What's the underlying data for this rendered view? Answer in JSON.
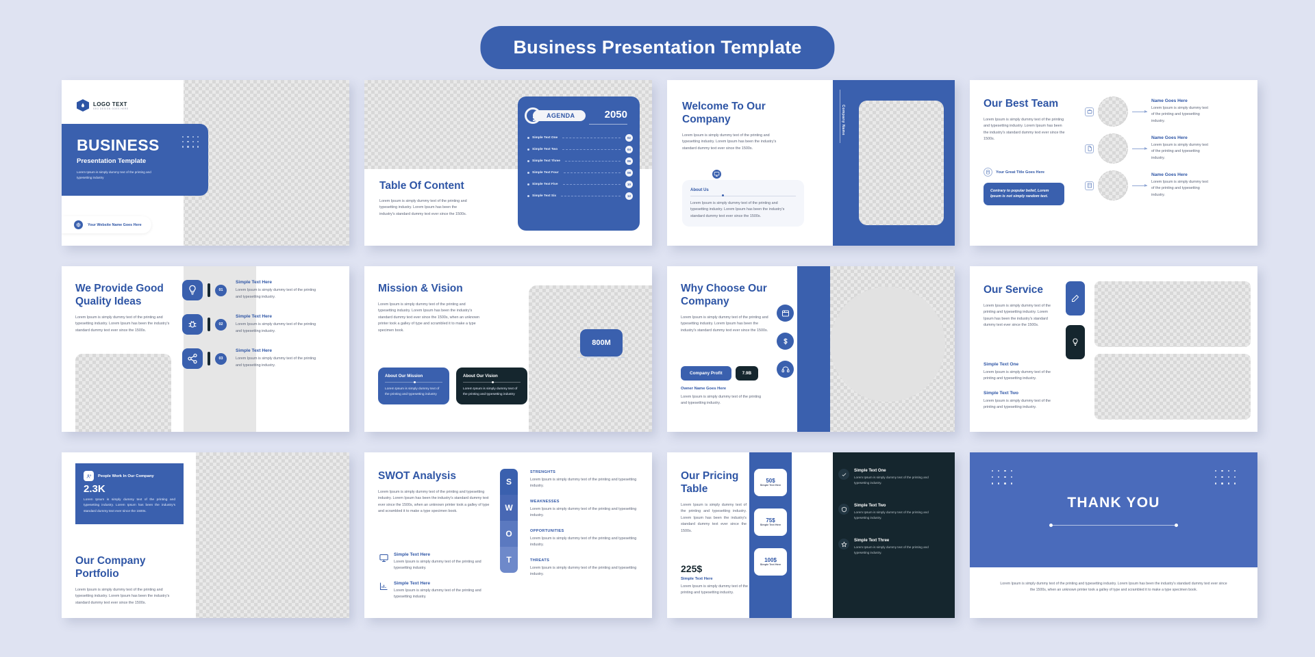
{
  "header": {
    "title": "Business Presentation Template",
    "accent": "#3a60ae"
  },
  "lorem": {
    "short": "Lorem Ipsum is simply dummy text of the printing and typesetting industry.",
    "medium": "Lorem Ipsum is simply dummy text of the printing and typesetting industry. Lorem Ipsum has been the industry's standard dummy text ever since the 1500s.",
    "long": "Lorem Ipsum is simply dummy text of the printing and typesetting industry. Lorem Ipsum has been the industry's standard dummy text ever since the 1500s, when an unknown printer took a galley of type and scrambled it to make a type specimen book.",
    "thanks": "Lorem Ipsum is simply dummy text of the printing and typesetting industry. Lorem Ipsum has been the industry's standard dummy text ever since the 1500s, when an unknown printer took a galley of type and scrambled it to make a type specimen book."
  },
  "slide1": {
    "logo_text": "LOGO TEXT",
    "logo_sub": "SEO DESIGN GOES HERE",
    "title": "BUSINESS",
    "subtitle": "Presentation Template",
    "desc": "Lorem Ipsum is simply dummy text of the printing and typesetting industry",
    "footer": "Your Website Name Goes Here"
  },
  "slide2": {
    "title": "Table Of Content",
    "desc": "Lorem Ipsum is simply dummy text of the printing and typesetting industry. Lorem Ipsum has been the industry's standard dummy text ever since the 1500s.",
    "agenda_label": "AGENDA",
    "year": "2050",
    "items": [
      {
        "label": "Simple Text One",
        "num": "02"
      },
      {
        "label": "Simple Text Two",
        "num": "04"
      },
      {
        "label": "Simple Text Three",
        "num": "06"
      },
      {
        "label": "Simple Text Four",
        "num": "08"
      },
      {
        "label": "Simple Text Five",
        "num": "10"
      },
      {
        "label": "Simple Text Six",
        "num": "12"
      }
    ]
  },
  "slide3": {
    "title": "Welcome To Our Company",
    "desc": "Lorem Ipsum is simply dummy text of the printing and typesetting industry. Lorem Ipsum has been the industry's standard dummy text ever since the 1500s.",
    "vertical_label": "Company Name",
    "about_title": "About Us",
    "about_desc": "Lorem Ipsum is simply dummy text of the printing and typesetting industry. Lorem Ipsum has been the industry's standard dummy text ever since the 1500s."
  },
  "slide4": {
    "title": "Our Best Team",
    "desc": "Lorem Ipsum is simply dummy text of the printing and typesetting industry. Lorem Ipsum has been the industry's standard dummy text ever since the 1500s.",
    "great_title": "Your Great Title Goes Here",
    "quote": "Contrary to popular belief, Lorem Ipsum is not simply random text.",
    "members": [
      {
        "name": "Name Goes Here",
        "desc": "Lorem Ipsum is simply dummy text of the printing and typesetting industry.",
        "icon": "briefcase-icon"
      },
      {
        "name": "Name Goes Here",
        "desc": "Lorem Ipsum is simply dummy text of the printing and typesetting industry.",
        "icon": "document-icon"
      },
      {
        "name": "Name Goes Here",
        "desc": "Lorem Ipsum is simply dummy text of the printing and typesetting industry.",
        "icon": "building-icon"
      }
    ]
  },
  "slide5": {
    "title": "We Provide Good Quality Ideas",
    "desc": "Lorem Ipsum is simply dummy text of the printing and typesetting industry. Lorem Ipsum has been the industry's standard dummy text ever since the 1500s.",
    "features": [
      {
        "num": "01",
        "title": "Simple Text Here",
        "desc": "Lorem Ipsum is simply dummy text of the printing and typesetting industry.",
        "icon": "lightbulb-icon"
      },
      {
        "num": "02",
        "title": "Simple Text Here",
        "desc": "Lorem Ipsum is simply dummy text of the printing and typesetting industry.",
        "icon": "bug-icon"
      },
      {
        "num": "03",
        "title": "Simple Text Here",
        "desc": "Lorem Ipsum is simply dummy text of the printing and typesetting industry.",
        "icon": "share-icon"
      }
    ]
  },
  "slide6": {
    "title": "Mission & Vision",
    "desc": "Lorem Ipsum is simply dummy text of the printing and typesetting industry. Lorem Ipsum has been the industry's standard dummy text ever since the 1500s, when an unknown printer took a galley of type and scrambled it to make a type specimen book.",
    "stat": "800M",
    "cards": [
      {
        "title": "About Our Mission",
        "desc": "Lorem Ipsum is simply dummy text of the printing and typesetting industry",
        "bg": "#3a60ae"
      },
      {
        "title": "About Our Vision",
        "desc": "Lorem Ipsum is simply dummy text of the printing and typesetting industry",
        "bg": "#15262e"
      }
    ]
  },
  "slide7": {
    "title": "Why Choose Our Company",
    "desc": "Lorem Ipsum is simply dummy text of the printing and typesetting industry. Lorem Ipsum has been the industry's standard dummy text ever since the 1500s.",
    "profit_label": "Company Profit",
    "profit_value": "7.9B",
    "owner": "Owner Name Goes Here",
    "owner_desc": "Lorem Ipsum is simply dummy text of the printing and typesetting industry."
  },
  "slide8": {
    "title": "Our Service",
    "desc": "Lorem Ipsum is simply dummy text of the printing and typesetting industry. Lorem Ipsum has been the industry's standard dummy text ever since the 1500s.",
    "items": [
      {
        "title": "Simple Text One",
        "desc": "Lorem Ipsum is simply dummy text of the printing and typesetting industry.",
        "icon": "edit-icon",
        "bg": "#3a60ae"
      },
      {
        "title": "Simple Text Two",
        "desc": "Lorem Ipsum is simply dummy text of the printing and typesetting industry.",
        "icon": "bulb-icon",
        "bg": "#15262e"
      }
    ]
  },
  "slide9": {
    "stat_label": "People Work In Our Company",
    "stat_value": "2.3K",
    "stat_desc": "Lorem Ipsum is simply dummy text of the printing and typesetting industry. Lorem Ipsum has been the industry's standard dummy text ever since the 1500s.",
    "title": "Our Company Portfolio",
    "desc": "Lorem Ipsum is simply dummy text of the printing and typesetting industry. Lorem Ipsum has been the industry's standard dummy text ever since the 1500s."
  },
  "slide10": {
    "title": "SWOT Analysis",
    "desc": "Lorem Ipsum is simply dummy text of the printing and typesetting industry. Lorem Ipsum has been the industry's standard dummy text ever since the 1500s, when an unknown printer took a galley of type and scrambled it to make a type specimen book.",
    "letters": [
      "S",
      "W",
      "O",
      "T"
    ],
    "features": [
      {
        "title": "Simple Text Here",
        "desc": "Lorem Ipsum is simply dummy text of the printing and typesetting industry.",
        "icon": "monitor-icon"
      },
      {
        "title": "Simple Text Here",
        "desc": "Lorem Ipsum is simply dummy text of the printing and typesetting industry.",
        "icon": "chart-icon"
      }
    ],
    "points": [
      {
        "title": "STRENGHTS",
        "desc": "Lorem Ipsum is simply dummy text of the printing and typesetting industry."
      },
      {
        "title": "WEAKNESSES",
        "desc": "Lorem Ipsum is simply dummy text of the printing and typesetting industry."
      },
      {
        "title": "OPPORTUNITIES",
        "desc": "Lorem Ipsum is simply dummy text of the printing and typesetting industry."
      },
      {
        "title": "THREATS",
        "desc": "Lorem Ipsum is simply dummy text of the printing and typesetting industry."
      }
    ]
  },
  "slide11": {
    "title": "Our Pricing Table",
    "desc": "Lorem Ipsum is simply dummy text of the printing and typesetting industry. Lorem Ipsum has been the industry's standard dummy text ever since the 1500s.",
    "big_price": "225$",
    "big_label": "Simple Text Here",
    "big_desc": "Lorem Ipsum is simply dummy text of the printing and typesetting industry.",
    "plans": [
      {
        "price": "50$",
        "sub": "Simple Text Here",
        "title": "Simple Text One",
        "desc": "Lorem Ipsum is simply dummy text of the printing and typesetting industry.",
        "icon": "check-icon"
      },
      {
        "price": "75$",
        "sub": "Simple Text Here",
        "title": "Simple Text Two",
        "desc": "Lorem Ipsum is simply dummy text of the printing and typesetting industry.",
        "icon": "shield-icon"
      },
      {
        "price": "100$",
        "sub": "Simple Text Here",
        "title": "Simple Text Three",
        "desc": "Lorem Ipsum is simply dummy text of the printing and typesetting industry.",
        "icon": "star-icon"
      }
    ]
  },
  "slide12": {
    "title": "THANK YOU",
    "desc": "Lorem Ipsum is simply dummy text of the printing and typesetting industry. Lorem Ipsum has been the industry's standard dummy text ever since the 1500s, when an unknown printer took a galley of type and scrambled it to make a type specimen book."
  }
}
